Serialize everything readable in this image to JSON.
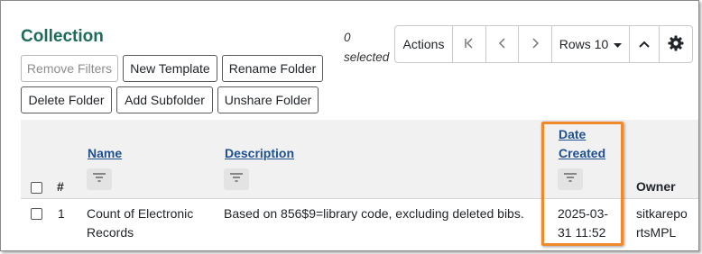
{
  "page": {
    "title": "Collection"
  },
  "toolbar": {
    "remove_filters": "Remove Filters",
    "new_template": "New Template",
    "rename_folder": "Rename Folder",
    "delete_folder": "Delete Folder",
    "add_subfolder": "Add Subfolder",
    "unshare_folder": "Unshare Folder"
  },
  "selection": {
    "count": "0",
    "label": "selected"
  },
  "pager": {
    "actions": "Actions",
    "first_icon": "first-page-icon",
    "prev_icon": "previous-page-icon",
    "next_icon": "next-page-icon",
    "rows_label": "Rows 10",
    "collapse_icon": "chevron-up-icon",
    "settings_icon": "gear-icon"
  },
  "table": {
    "columns": {
      "number": "#",
      "name": "Name",
      "description": "Description",
      "date_created_line1": "Date",
      "date_created_line2": "Created",
      "owner": "Owner"
    },
    "rows": [
      {
        "number": "1",
        "name_line1": "Count of Electronic",
        "name_line2": "Records",
        "description": "Based on 856$9=library code, excluding deleted bibs.",
        "date_line1": "2025-03-",
        "date_line2": "31 11:52",
        "owner_line1": "sitkarepo",
        "owner_line2": "rtsMPL"
      }
    ]
  },
  "colors": {
    "title": "#1e6b5c",
    "link": "#1d4f91",
    "highlight": "#ee8a2b",
    "header_bg": "#f1f1f1"
  }
}
